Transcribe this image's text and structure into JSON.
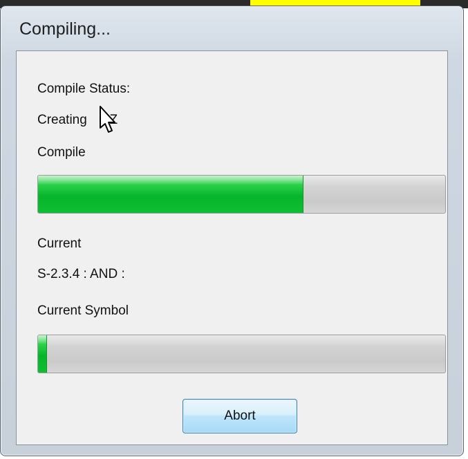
{
  "window": {
    "title": "Compiling..."
  },
  "status": {
    "label": "Compile Status:",
    "text_before_cursor": "Creating",
    "text_after_cursor": "PZ"
  },
  "compile": {
    "label": "Compile",
    "progress": 0.65
  },
  "current": {
    "label": "Current",
    "text": "S-2.3.4 : AND :"
  },
  "current_symbol": {
    "label": "Current Symbol",
    "progress": 0.02
  },
  "buttons": {
    "abort_label": "Abort"
  },
  "colors": {
    "progress_fill": "#06b52b",
    "highlight": "#ffff00"
  }
}
